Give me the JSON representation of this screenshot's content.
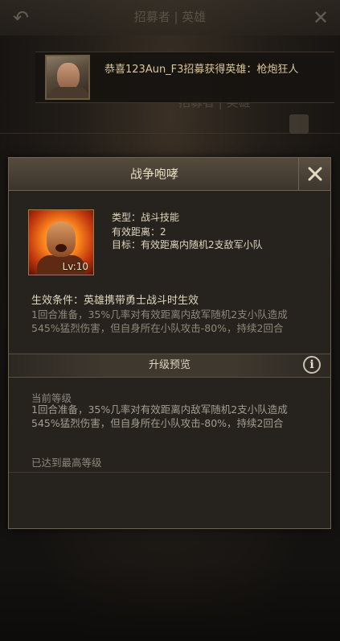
{
  "background": {
    "window_title": "招募者 | 英雄",
    "inner_title": "招募者 | 英雄"
  },
  "banner": {
    "message": "恭喜123Aun_F3招募获得英雄：枪炮狂人"
  },
  "dialog": {
    "title": "战争咆哮",
    "skill": {
      "level_label": "Lv:10",
      "type": "类型：战斗技能",
      "range": "有效距离：2",
      "target": "目标：有效距离内随机2支敌军小队"
    },
    "condition": "生效条件：英雄携带勇士战斗时生效",
    "description": "1回合准备，35%几率对有效距离内敌军随机2支小队造成545%猛烈伤害，但自身所在小队攻击-80%，持续2回合",
    "upgrade_preview": {
      "title": "升级预览",
      "current_level_label": "当前等级",
      "current_level_desc": "1回合准备，35%几率对有效距离内敌军随机2支小队造成545%猛烈伤害，但自身所在小队攻击-80%，持续2回合",
      "max_level_text": "已达到最高等级"
    }
  },
  "icons": {
    "back": "back-arrow-icon",
    "close": "close-icon",
    "info": "info-icon"
  },
  "colors": {
    "accent_gold": "#d8c79b",
    "panel_border": "#6f6452",
    "text_primary": "#e0d6bd",
    "text_muted": "#8f877a"
  }
}
